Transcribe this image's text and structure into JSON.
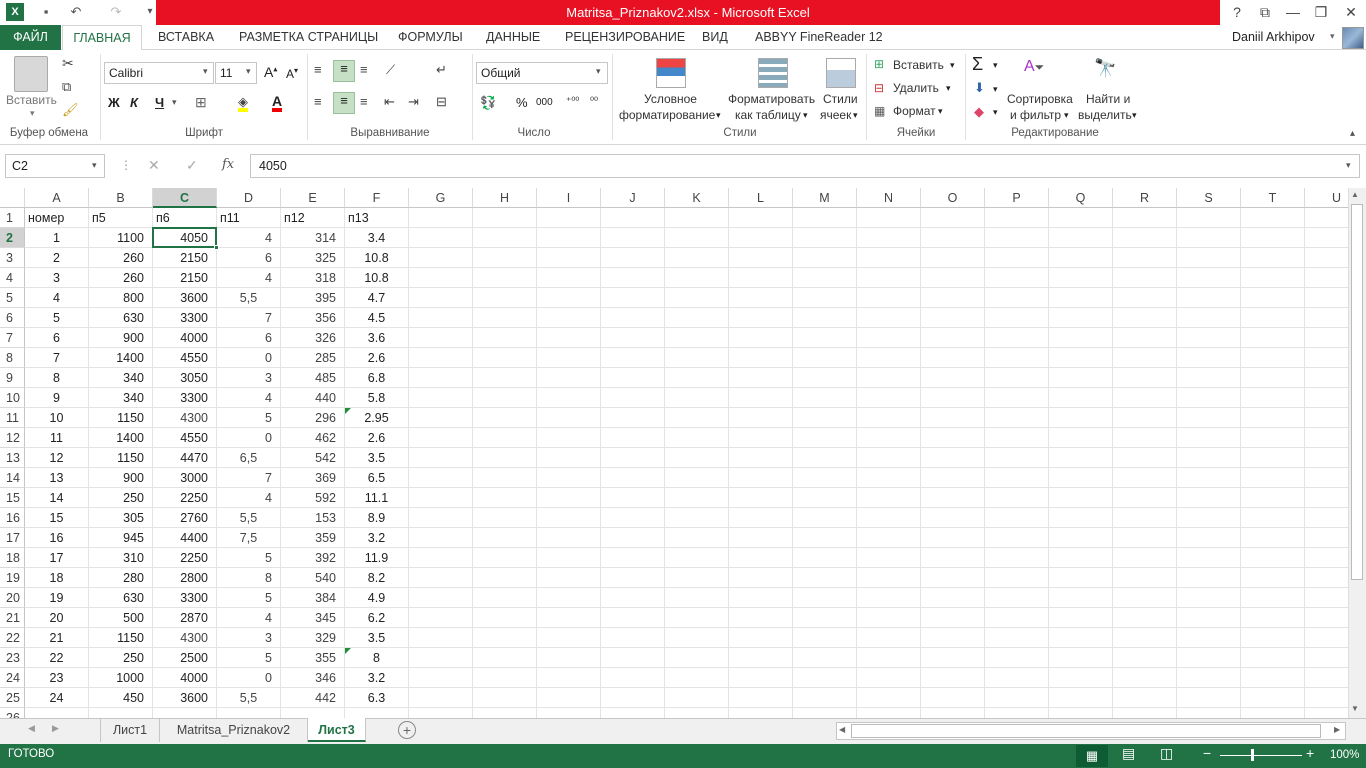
{
  "app": {
    "title": "Matritsa_Priznakov2.xlsx -  Microsoft Excel",
    "user": "Daniil Arkhipov"
  },
  "tabs": [
    "ФАЙЛ",
    "ГЛАВНАЯ",
    "ВСТАВКА",
    "РАЗМЕТКА СТРАНИЦЫ",
    "ФОРМУЛЫ",
    "ДАННЫЕ",
    "РЕЦЕНЗИРОВАНИЕ",
    "ВИД",
    "ABBYY FineReader 12"
  ],
  "ribbon": {
    "paste": "Вставить",
    "clipboard": "Буфер обмена",
    "font_name": "Calibri",
    "font_size": "11",
    "bold": "Ж",
    "italic": "К",
    "underline": "Ч",
    "font": "Шрифт",
    "alignment": "Выравнивание",
    "number_format": "Общий",
    "number": "Число",
    "cond_fmt_1": "Условное",
    "cond_fmt_2": "форматирование",
    "fmt_table_1": "Форматировать",
    "fmt_table_2": "как таблицу",
    "cell_styles_1": "Стили",
    "cell_styles_2": "ячеек",
    "styles": "Стили",
    "insert": "Вставить",
    "delete": "Удалить",
    "format": "Формат",
    "cells": "Ячейки",
    "sort_1": "Сортировка",
    "sort_2": "и фильтр",
    "find_1": "Найти и",
    "find_2": "выделить",
    "editing": "Редактирование"
  },
  "formula_bar": {
    "name_box": "C2",
    "fx": "fx",
    "value": "4050"
  },
  "columns": [
    "A",
    "B",
    "C",
    "D",
    "E",
    "F",
    "G",
    "H",
    "I",
    "J",
    "K",
    "L",
    "M",
    "N",
    "O",
    "P",
    "Q",
    "R",
    "S",
    "T",
    "U"
  ],
  "rows": [
    [
      "номер",
      "п5",
      "п6",
      "п11",
      "п12",
      "п13"
    ],
    [
      "1",
      "1100",
      "4050",
      "4",
      "314",
      "3.4"
    ],
    [
      "2",
      "260",
      "2150",
      "6",
      "325",
      "10.8"
    ],
    [
      "3",
      "260",
      "2150",
      "4",
      "318",
      "10.8"
    ],
    [
      "4",
      "800",
      "3600",
      "5,5",
      "395",
      "4.7"
    ],
    [
      "5",
      "630",
      "3300",
      "7",
      "356",
      "4.5"
    ],
    [
      "6",
      "900",
      "4000",
      "6",
      "326",
      "3.6"
    ],
    [
      "7",
      "1400",
      "4550",
      "0",
      "285",
      "2.6"
    ],
    [
      "8",
      "340",
      "3050",
      "3",
      "485",
      "6.8"
    ],
    [
      "9",
      "340",
      "3300",
      "4",
      "440",
      "5.8"
    ],
    [
      "10",
      "1150",
      "4300",
      "5",
      "296",
      "2.95"
    ],
    [
      "11",
      "1400",
      "4550",
      "0",
      "462",
      "2.6"
    ],
    [
      "12",
      "1150",
      "4470",
      "6,5",
      "542",
      "3.5"
    ],
    [
      "13",
      "900",
      "3000",
      "7",
      "369",
      "6.5"
    ],
    [
      "14",
      "250",
      "2250",
      "4",
      "592",
      "11.1"
    ],
    [
      "15",
      "305",
      "2760",
      "5,5",
      "153",
      "8.9"
    ],
    [
      "16",
      "945",
      "4400",
      "7,5",
      "359",
      "3.2"
    ],
    [
      "17",
      "310",
      "2250",
      "5",
      "392",
      "11.9"
    ],
    [
      "18",
      "280",
      "2800",
      "8",
      "540",
      "8.2"
    ],
    [
      "19",
      "630",
      "3300",
      "5",
      "384",
      "4.9"
    ],
    [
      "20",
      "500",
      "2870",
      "4",
      "345",
      "6.2"
    ],
    [
      "21",
      "1150",
      "4300",
      "3",
      "329",
      "3.5"
    ],
    [
      "22",
      "250",
      "2500",
      "5",
      "355",
      "8"
    ],
    [
      "23",
      "1000",
      "4000",
      "0",
      "346",
      "3.2"
    ],
    [
      "24",
      "450",
      "3600",
      "5,5",
      "442",
      "6.3"
    ]
  ],
  "sheets": [
    "Лист1",
    "Matritsa_Priznakov2",
    "Лист3"
  ],
  "status": {
    "ready": "ГОТОВО",
    "zoom": "100%"
  }
}
